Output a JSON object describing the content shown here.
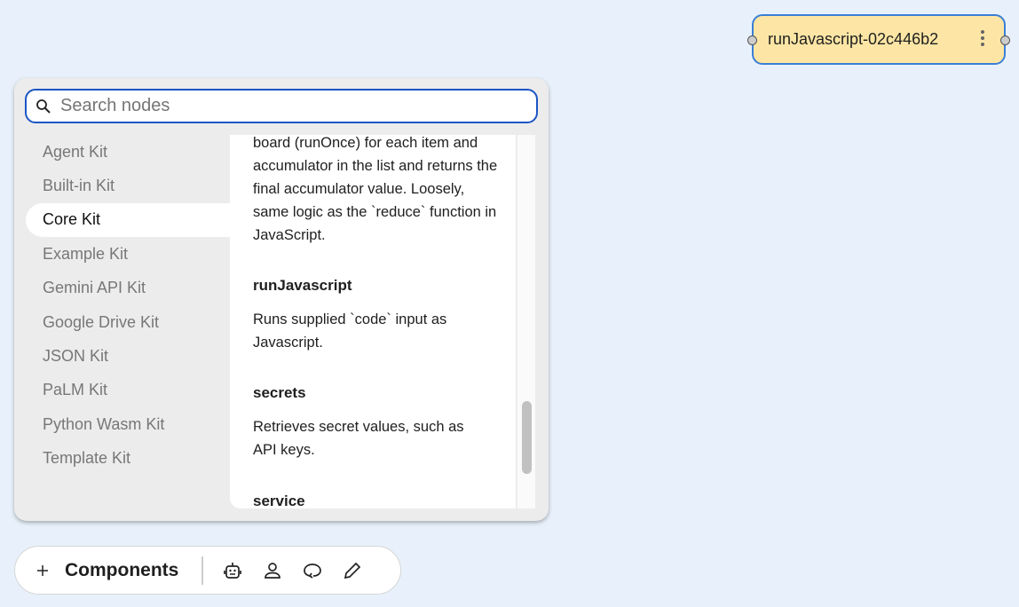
{
  "node": {
    "title": "runJavascript-02c446b2",
    "menu_icon": "kebab-icon"
  },
  "search": {
    "placeholder": "Search nodes",
    "value": ""
  },
  "kits": [
    {
      "label": "Agent Kit"
    },
    {
      "label": "Built-in Kit"
    },
    {
      "label": "Core Kit",
      "active": true
    },
    {
      "label": "Example Kit"
    },
    {
      "label": "Gemini API Kit"
    },
    {
      "label": "Google Drive Kit"
    },
    {
      "label": "JSON Kit"
    },
    {
      "label": "PaLM Kit"
    },
    {
      "label": "Python Wasm Kit"
    },
    {
      "label": "Template Kit"
    }
  ],
  "entries": [
    {
      "title": "",
      "description": "board (runOnce) for each item and accumulator in the list and returns the final accumulator value. Loosely, same logic as the `reduce` function in JavaScript."
    },
    {
      "title": "runJavascript",
      "description": "Runs supplied `code` input as Javascript."
    },
    {
      "title": "secrets",
      "description": "Retrieves secret values, such as API keys."
    },
    {
      "title": "service",
      "description": ""
    }
  ],
  "toolbar": {
    "components_label": "Components",
    "icons": [
      "plus-icon",
      "robot-icon",
      "person-icon",
      "chat-loop-icon",
      "pencil-icon"
    ]
  },
  "colors": {
    "accent": "#1a56c4",
    "node_bg": "#fde6a5",
    "node_border": "#3a7fd6"
  }
}
